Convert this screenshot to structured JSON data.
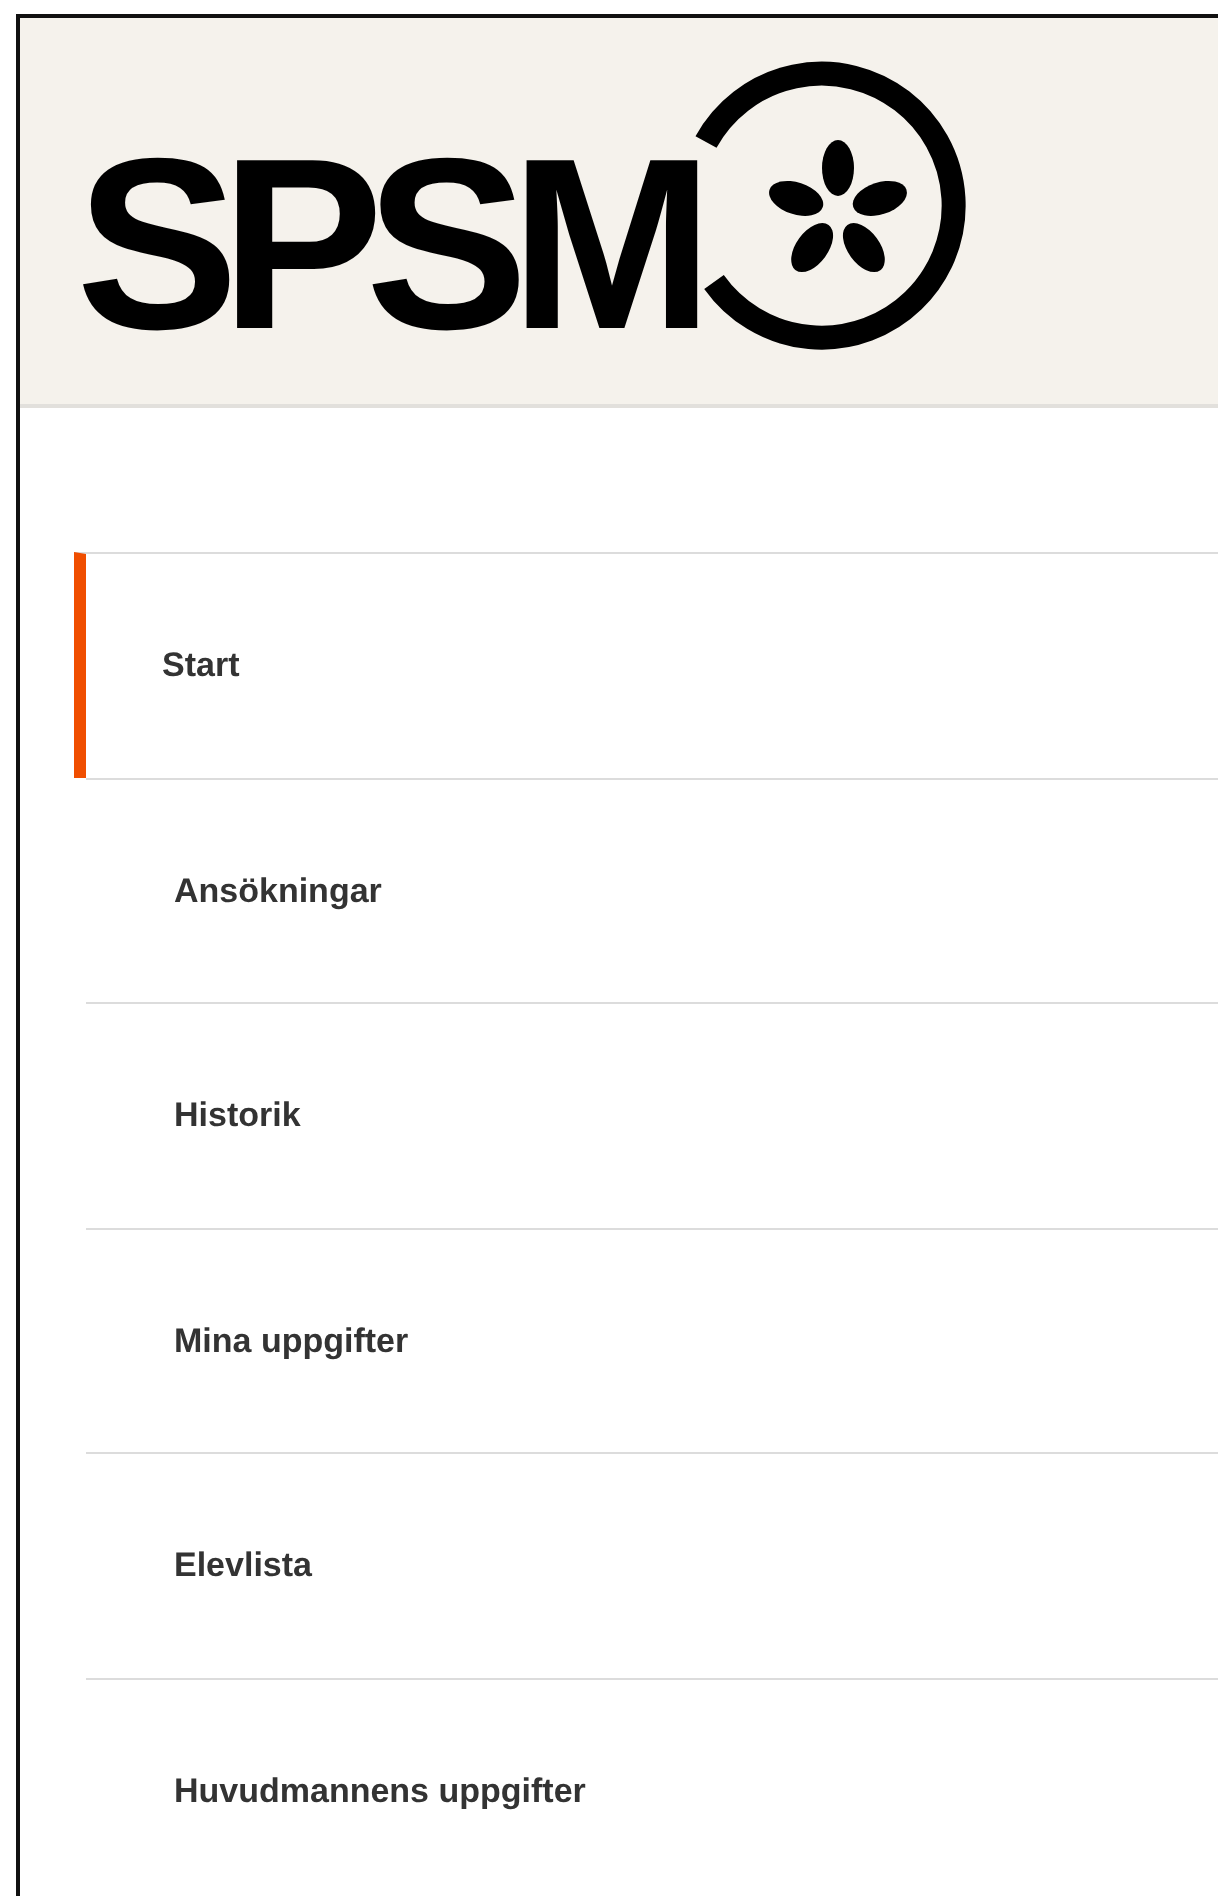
{
  "header": {
    "logo_text": "SPSM"
  },
  "nav": {
    "items": [
      {
        "label": "Start",
        "selected": true
      },
      {
        "label": "Ansökningar",
        "selected": false
      },
      {
        "label": "Historik",
        "selected": false
      },
      {
        "label": "Mina uppgifter",
        "selected": false
      },
      {
        "label": "Elevlista",
        "selected": false
      },
      {
        "label": "Huvudmannens uppgifter",
        "selected": false
      }
    ]
  }
}
